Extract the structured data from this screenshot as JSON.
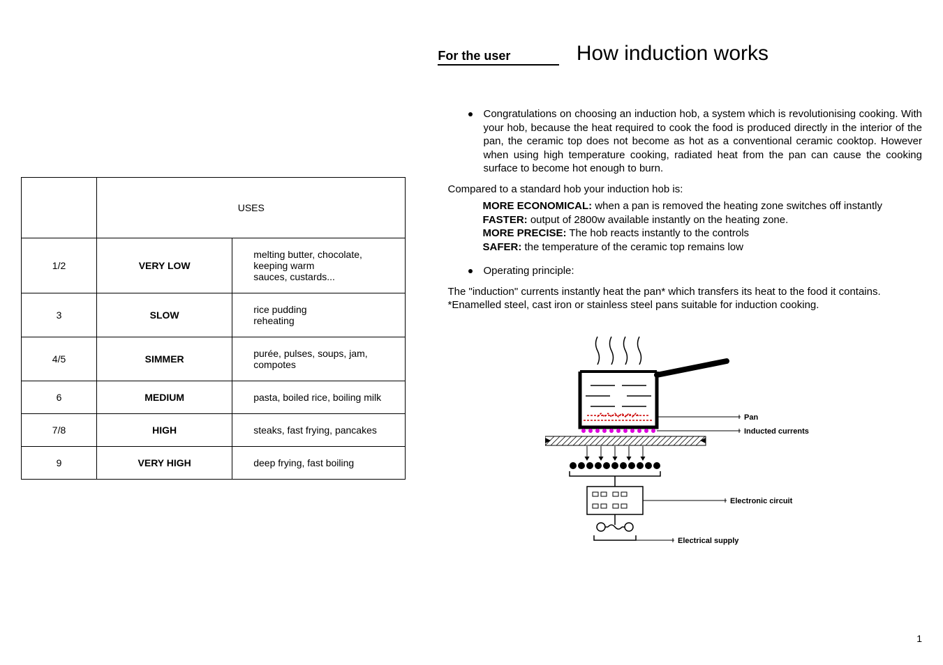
{
  "header": {
    "for_user": "For the user",
    "title": "How induction works"
  },
  "table": {
    "header_col1": "",
    "header_col2": "USES",
    "rows": [
      {
        "level": "1/2",
        "name": "VERY LOW",
        "uses": "melting butter, chocolate, keeping warm\nsauces, custards..."
      },
      {
        "level": "3",
        "name": "SLOW",
        "uses": "rice pudding\nreheating"
      },
      {
        "level": "4/5",
        "name": "SIMMER",
        "uses": "purée, pulses, soups, jam, compotes"
      },
      {
        "level": "6",
        "name": "MEDIUM",
        "uses": "pasta, boiled rice, boiling milk"
      },
      {
        "level": "7/8",
        "name": "HIGH",
        "uses": "steaks, fast frying, pancakes"
      },
      {
        "level": "9",
        "name": "VERY HIGH",
        "uses": "deep frying, fast boiling"
      }
    ]
  },
  "intro": "Congratulations on choosing an induction hob, a system which is revolutionising cooking. With your hob, because the heat required to cook the food is produced directly in the interior of the pan, the ceramic top does not become as hot as a conventional ceramic cooktop. However when using high temperature cooking, radiated heat from the pan can cause the cooking surface to become hot enough to burn.",
  "compare_intro": "Compared to a standard hob your induction hob is:",
  "compare": [
    {
      "label": "MORE ECONOMICAL:",
      "text": " when a pan is removed the heating zone switches off instantly"
    },
    {
      "label": "FASTER:",
      "text": " output of 2800w available instantly on the heating zone."
    },
    {
      "label": "MORE PRECISE:",
      "text": " The hob reacts instantly to the controls"
    },
    {
      "label": "SAFER:",
      "text": " the temperature of the ceramic top remains low"
    }
  ],
  "principle_label": "Operating principle:",
  "principle_text": "The \"induction\" currents instantly heat the pan* which transfers its heat to the food it contains.",
  "footnote": "*Enamelled steel, cast iron or stainless steel pans suitable for induction cooking.",
  "diagram": {
    "pan": "Pan",
    "inducted": "Inducted currents",
    "circuit": "Electronic circuit",
    "supply": "Electrical supply"
  },
  "page_number": "1"
}
